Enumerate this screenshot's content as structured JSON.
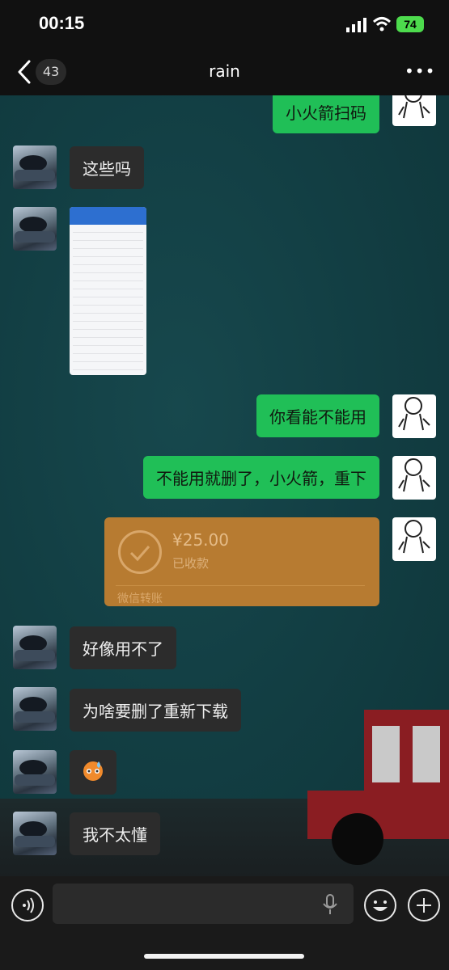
{
  "status_bar": {
    "time": "00:15",
    "battery": "74"
  },
  "nav": {
    "back_count": "43",
    "title": "rain",
    "more": "•••"
  },
  "messages": {
    "m1": "小火箭扫码",
    "m2": "这些吗",
    "m4": "你看能不能用",
    "m5": "不能用就删了，小火箭，重下",
    "m7": "好像用不了",
    "m8": "为啥要删了重新下载",
    "m10": "我不太懂"
  },
  "transfer": {
    "amount": "¥25.00",
    "status": "已收款",
    "label": "微信转账"
  },
  "icons": [
    "back-chevron-icon",
    "signal-icon",
    "wifi-icon",
    "battery-icon",
    "more-icon",
    "voice-icon",
    "microphone-icon",
    "emoji-icon",
    "plus-icon",
    "check-icon"
  ],
  "colors": {
    "sent_bubble": "#20bf57",
    "received_bubble": "#2c2c2c",
    "transfer_card": "#b77b31"
  }
}
